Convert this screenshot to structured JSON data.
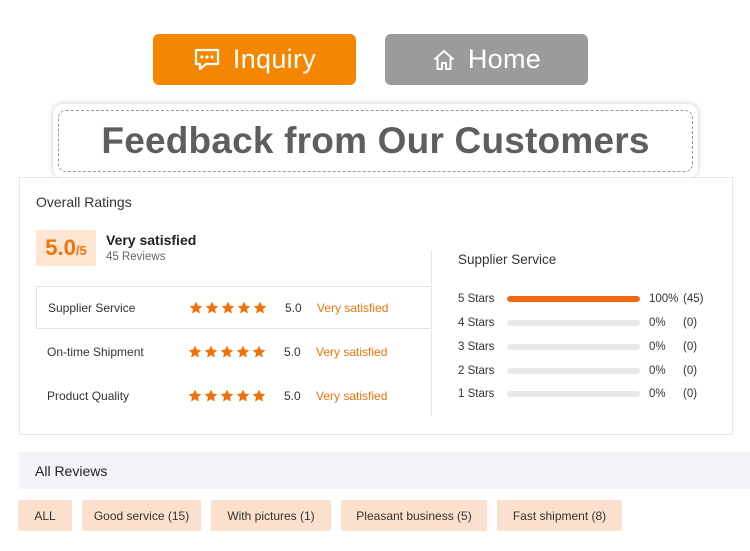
{
  "buttons": {
    "inquiry": {
      "label": "Inquiry",
      "icon": "chat-bubble-icon",
      "color": "#f58700"
    },
    "home": {
      "label": "Home",
      "icon": "house-icon",
      "color": "#9b9b9b"
    }
  },
  "headline": "Feedback from Our Customers",
  "overall": {
    "title": "Overall Ratings",
    "score": "5.0",
    "score_suffix": "/5",
    "summary": "Very satisfied",
    "review_count": "45 Reviews"
  },
  "ratings": [
    {
      "label": "Supplier Service",
      "stars": 5,
      "value": "5.0",
      "text": "Very satisfied"
    },
    {
      "label": "On-time Shipment",
      "stars": 5,
      "value": "5.0",
      "text": "Very satisfied"
    },
    {
      "label": "Product Quality",
      "stars": 5,
      "value": "5.0",
      "text": "Very satisfied"
    }
  ],
  "supplier_service": {
    "title": "Supplier Service",
    "distribution": [
      {
        "label": "5 Stars",
        "fraction": 1.0,
        "percent": "100%",
        "count": "(45)"
      },
      {
        "label": "4 Stars",
        "fraction": 0.0,
        "percent": "0%",
        "count": "(0)"
      },
      {
        "label": "3 Stars",
        "fraction": 0.0,
        "percent": "0%",
        "count": "(0)"
      },
      {
        "label": "2 Stars",
        "fraction": 0.0,
        "percent": "0%",
        "count": "(0)"
      },
      {
        "label": "1 Stars",
        "fraction": 0.0,
        "percent": "0%",
        "count": "(0)"
      }
    ]
  },
  "all_reviews": {
    "title": "All Reviews",
    "tags": [
      "ALL",
      "Good service (15)",
      "With pictures (1)",
      "Pleasant business (5)",
      "Fast shipment (8)"
    ]
  },
  "colors": {
    "accent": "#f0730a",
    "bar_fill": "#f26a10",
    "tag_bg": "#fbe1cd"
  }
}
